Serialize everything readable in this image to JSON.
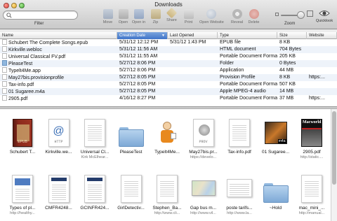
{
  "window": {
    "title": "Downloads"
  },
  "search": {
    "placeholder": "",
    "label": "Filter"
  },
  "toolbar": {
    "buttons": [
      {
        "label": "Move",
        "icon": "move-icon"
      },
      {
        "label": "Open",
        "icon": "open-icon"
      },
      {
        "label": "Open in",
        "icon": "open-in-icon"
      },
      {
        "label": "Zip",
        "icon": "zip-icon"
      },
      {
        "label": "Share",
        "icon": "share-icon"
      },
      {
        "label": "Print",
        "icon": "print-icon"
      },
      {
        "label": "Open Website",
        "icon": "globe-icon"
      },
      {
        "label": "Reveal",
        "icon": "reveal-icon"
      },
      {
        "label": "Delete",
        "icon": "delete-icon"
      }
    ],
    "zoom_label": "Zoom",
    "quicklook_label": "Quicklook"
  },
  "list": {
    "columns": [
      "Name",
      "Creation Date",
      "Last Opened",
      "Type",
      "Size",
      "Website"
    ],
    "sorted_column": "Creation Date",
    "rows": [
      [
        "Schubert The Complete Songs.epub",
        "5/31/12 12:12 PM",
        "5/31/12 1:43 PM",
        "EPUB file",
        "8 KB",
        ""
      ],
      [
        "Kirkville.webloc",
        "5/31/12 11:56 AM",
        "",
        "HTML document",
        "704 Bytes",
        ""
      ],
      [
        "Universal Classical FV.pdf",
        "5/31/12 11:55 AM",
        "",
        "Portable Document Format",
        "205 KB",
        ""
      ],
      [
        "PleaseTest",
        "5/27/12 8:06 PM",
        "",
        "Folder",
        "0 Bytes",
        ""
      ],
      [
        "Typelt4Me.app",
        "5/27/12 8:06 PM",
        "",
        "Application",
        "44 MB",
        ""
      ],
      [
        "May27bis.provisionprofile",
        "5/27/12 8:05 PM",
        "",
        "Provision Profile",
        "8 KB",
        "https:..."
      ],
      [
        "Tax-info.pdf",
        "5/27/12 8:05 PM",
        "",
        "Portable Document Format",
        "507 KB",
        ""
      ],
      [
        "01 Sugaree.m4a",
        "5/27/12 8:05 PM",
        "",
        "Apple MPEG-4 audio",
        "14 MB",
        ""
      ],
      [
        "2905.pdf",
        "4/16/12 8:27 PM",
        "",
        "Portable Document Format",
        "37 MB",
        "https:..."
      ]
    ]
  },
  "grid": {
    "row1": [
      {
        "name": "Schubert T...",
        "sub": "",
        "kind": "book",
        "tag": "EPUB"
      },
      {
        "name": "Kirkville.we...",
        "sub": "",
        "kind": "http",
        "tag": "HTTP"
      },
      {
        "name": "Universal Cl...",
        "sub": "Kirk McElhear...",
        "kind": "doc",
        "tag": ""
      },
      {
        "name": "PleaseTest",
        "sub": "",
        "kind": "folder",
        "tag": ""
      },
      {
        "name": "TypeIt4Me...",
        "sub": "",
        "kind": "person",
        "tag": ""
      },
      {
        "name": "May27bis.pr...",
        "sub": "https://develo...",
        "kind": "prov",
        "tag": "PROV"
      },
      {
        "name": "Tax-info.pdf",
        "sub": "",
        "kind": "doc",
        "tag": ""
      },
      {
        "name": "01 Sugaree...",
        "sub": "",
        "kind": "audio",
        "tag": "m4a"
      },
      {
        "name": "2905.pdf",
        "sub": "http://static....",
        "kind": "mag",
        "tag": "Macworld"
      }
    ],
    "row2": [
      {
        "name": "Types of pl...",
        "sub": "http://healthy...",
        "kind": "blue",
        "tag": ""
      },
      {
        "name": "CMFR4248...",
        "sub": "",
        "kind": "mark",
        "tag": ""
      },
      {
        "name": "GCINFR424...",
        "sub": "",
        "kind": "mark",
        "tag": ""
      },
      {
        "name": "GirlDetectiv...",
        "sub": "",
        "kind": "doc",
        "tag": ""
      },
      {
        "name": "Stephen_Ba...",
        "sub": "http://www.cli...",
        "kind": "doc",
        "tag": ""
      },
      {
        "name": "Gap bus m...",
        "sub": "http://www.vil...",
        "kind": "map",
        "tag": ""
      },
      {
        "name": "poste tarifs...",
        "sub": "http://www.la...",
        "kind": "land",
        "tag": ""
      },
      {
        "name": "~Hold",
        "sub": "",
        "kind": "folder",
        "tag": ""
      },
      {
        "name": "mac_mini_...",
        "sub": "http://manual...",
        "kind": "doc",
        "tag": ""
      }
    ]
  },
  "colors": {
    "accent": "#3f74c8",
    "selection_alt": "#eef3fa"
  }
}
